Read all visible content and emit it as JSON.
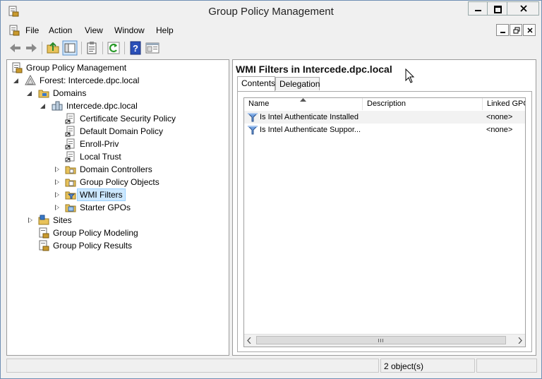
{
  "window": {
    "title": "Group Policy Management"
  },
  "menu": [
    "File",
    "Action",
    "View",
    "Window",
    "Help"
  ],
  "tree": {
    "root": "Group Policy Management",
    "forest": "Forest: Intercede.dpc.local",
    "domains": "Domains",
    "domain": "Intercede.dpc.local",
    "children": [
      "Certificate Security Policy",
      "Default Domain Policy",
      "Enroll-Priv",
      "Local Trust",
      "Domain Controllers",
      "Group Policy Objects",
      "WMI Filters",
      "Starter GPOs"
    ],
    "sites": "Sites",
    "modeling": "Group Policy Modeling",
    "results": "Group Policy Results"
  },
  "detail": {
    "title": "WMI Filters in Intercede.dpc.local",
    "tabs": [
      "Contents",
      "Delegation"
    ],
    "columns": [
      "Name",
      "Description",
      "Linked GPO"
    ],
    "rows": [
      {
        "name": "Is Intel Authenticate Installed",
        "description": "",
        "linked": "<none>"
      },
      {
        "name": "Is Intel Authenticate Suppor...",
        "description": "",
        "linked": "<none>"
      }
    ]
  },
  "status": {
    "count": "2 object(s)"
  },
  "icons": {
    "app": "gpmc-icon",
    "back": "back-arrow-icon",
    "forward": "forward-arrow-icon",
    "up": "up-folder-icon",
    "showhide": "show-hide-tree-icon",
    "properties": "properties-icon",
    "refresh": "refresh-icon",
    "help": "help-icon",
    "console": "console-icon"
  }
}
